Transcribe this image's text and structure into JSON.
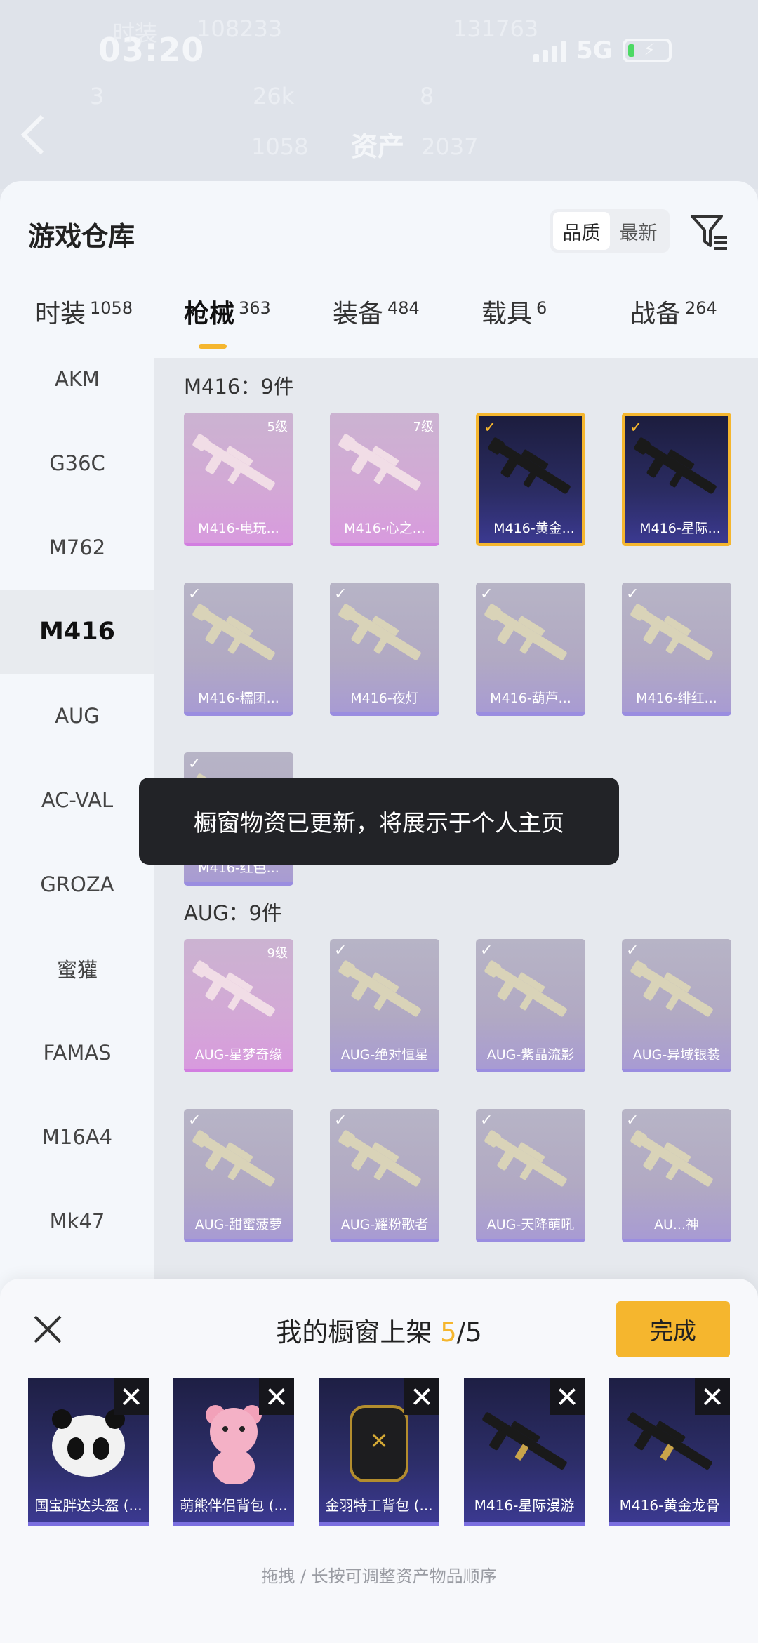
{
  "status_bar": {
    "time": "03:20",
    "network": "5G"
  },
  "background_header": {
    "title": "资产",
    "faded_texts": [
      "时装",
      "108233",
      "131763",
      "3",
      "26k",
      "8",
      "1058",
      "2037"
    ]
  },
  "sheet": {
    "title": "游戏仓库",
    "sort_options": [
      "品质",
      "最新"
    ],
    "active_sort": "品质",
    "tabs": [
      {
        "label": "时装",
        "count": "1058"
      },
      {
        "label": "枪械",
        "count": "363"
      },
      {
        "label": "装备",
        "count": "484"
      },
      {
        "label": "载具",
        "count": "6"
      },
      {
        "label": "战备",
        "count": "264"
      }
    ],
    "active_tab": "枪械",
    "sidebar": [
      "AKM",
      "G36C",
      "M762",
      "M416",
      "AUG",
      "AC-VAL",
      "GROZA",
      "蜜獾",
      "FAMAS",
      "M16A4",
      "Mk47"
    ],
    "active_sidebar": "M416"
  },
  "sections": [
    {
      "title": "M416：9件",
      "items": [
        {
          "label": "M416-电玩...",
          "rarity": "pink",
          "level": "5级",
          "checked": false
        },
        {
          "label": "M416-心之...",
          "rarity": "pink",
          "level": "7级",
          "checked": false
        },
        {
          "label": "M416-黄金...",
          "rarity": "gold",
          "level": "",
          "checked": true
        },
        {
          "label": "M416-星际...",
          "rarity": "gold",
          "level": "",
          "checked": true
        },
        {
          "label": "M416-糯团...",
          "rarity": "purple",
          "level": "",
          "checked": true
        },
        {
          "label": "M416-夜灯",
          "rarity": "purple",
          "level": "",
          "checked": true
        },
        {
          "label": "M416-葫芦...",
          "rarity": "purple",
          "level": "",
          "checked": true
        },
        {
          "label": "M416-绯红...",
          "rarity": "purple",
          "level": "",
          "checked": true
        },
        {
          "label": "M416-红色...",
          "rarity": "purple",
          "level": "",
          "checked": true
        }
      ]
    },
    {
      "title": "AUG：9件",
      "items": [
        {
          "label": "AUG-星梦奇缘",
          "rarity": "pink",
          "level": "9级",
          "checked": false
        },
        {
          "label": "AUG-绝对恒星",
          "rarity": "purple",
          "level": "",
          "checked": true
        },
        {
          "label": "AUG-紫晶流影",
          "rarity": "purple",
          "level": "",
          "checked": true
        },
        {
          "label": "AUG-异域银装",
          "rarity": "purple",
          "level": "",
          "checked": true
        },
        {
          "label": "AUG-甜蜜菠萝",
          "rarity": "purple",
          "level": "",
          "checked": true
        },
        {
          "label": "AUG-耀粉歌者",
          "rarity": "purple",
          "level": "",
          "checked": true
        },
        {
          "label": "AUG-天降萌吼",
          "rarity": "purple",
          "level": "",
          "checked": true
        },
        {
          "label": "AU...神",
          "rarity": "purple",
          "level": "",
          "checked": true
        }
      ]
    }
  ],
  "toast": "橱窗物资已更新，将展示于个人主页",
  "showcase": {
    "title_prefix": "我的橱窗上架",
    "current": "5",
    "separator": "/",
    "max": "5",
    "done_label": "完成",
    "items": [
      {
        "label": "国宝胖达头盔 (...",
        "icon": "panda-helmet-icon"
      },
      {
        "label": "萌熊伴侣背包 (...",
        "icon": "pink-bear-backpack-icon"
      },
      {
        "label": "金羽特工背包 (...",
        "icon": "black-gold-backpack-icon"
      },
      {
        "label": "M416-星际漫游",
        "icon": "rifle-icon"
      },
      {
        "label": "M416-黄金龙骨",
        "icon": "rifle-icon"
      }
    ],
    "hint": "拖拽 / 长按可调整资产物品顺序"
  },
  "colors": {
    "accent": "#f5b62e",
    "rarity_pink": "#d27ee0",
    "rarity_purple": "#9a8de0",
    "rarity_gold_bg": "#2b2c63",
    "toast_bg": "#222327"
  }
}
